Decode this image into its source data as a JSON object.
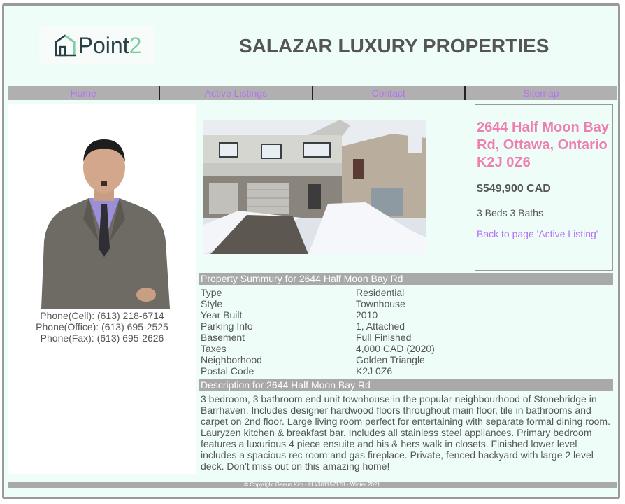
{
  "logo": {
    "text_main": "Point",
    "text_accent": "2"
  },
  "site_title": "SALAZAR LUXURY PROPERTIES",
  "nav": [
    "Home",
    "Active Listings",
    "Contact",
    "Sitemap"
  ],
  "agent": {
    "phone_cell": "Phone(Cell): (613) 218-6714",
    "phone_office": "Phone(Office): (613) 695-2525",
    "phone_fax": "Phone(Fax): (613) 695-2626"
  },
  "listing": {
    "address": "2644 Half Moon Bay Rd, Ottawa, Ontario K2J 0Z6",
    "price": "$549,900 CAD",
    "beds_baths": "3 Beds 3 Baths",
    "back_link": "Back to page 'Active Listing'"
  },
  "summary": {
    "header": "Property Summury for 2644 Half Moon Bay Rd",
    "rows": [
      {
        "label": "Type",
        "value": "Residential"
      },
      {
        "label": "Style",
        "value": "Townhouse"
      },
      {
        "label": "Year Built",
        "value": "2010"
      },
      {
        "label": "Parking Info",
        "value": "1, Attached"
      },
      {
        "label": "Basement",
        "value": "Full Finished"
      },
      {
        "label": "Taxes",
        "value": "4,000 CAD (2020)"
      },
      {
        "label": "Neighborhood",
        "value": "Golden Triangle"
      },
      {
        "label": "Postal Code",
        "value": "K2J 0Z6"
      }
    ]
  },
  "description": {
    "header": "Description for 2644 Half Moon Bay Rd",
    "text": "3 bedroom, 3 bathroom end unit townhouse in the popular neighbourhood of Stonebridge in Barrhaven. Includes designer hardwood floors throughout main floor, tile in bathrooms and carpet on 2nd floor. Large living room perfect for entertaining with separate formal dining room. Lauryzen kitchen & breakfast bar. Includes all stainless steel appliances. Primary bedroom features a luxurious 4 piece ensuite and his & hers walk in closets. Finished lower level includes a spacious rec room and gas fireplace. Private, fenced backyard with large 2 level deck. Don't miss out on this amazing home!"
  },
  "footer": "© Copyright Gaeun Kim - Id #301157178 - Winter 2021",
  "colors": {
    "accent_link": "#b76ff7",
    "address_pink": "#ef7fae",
    "background": "#effdf8",
    "bar_gray": "#a9a9a9"
  }
}
